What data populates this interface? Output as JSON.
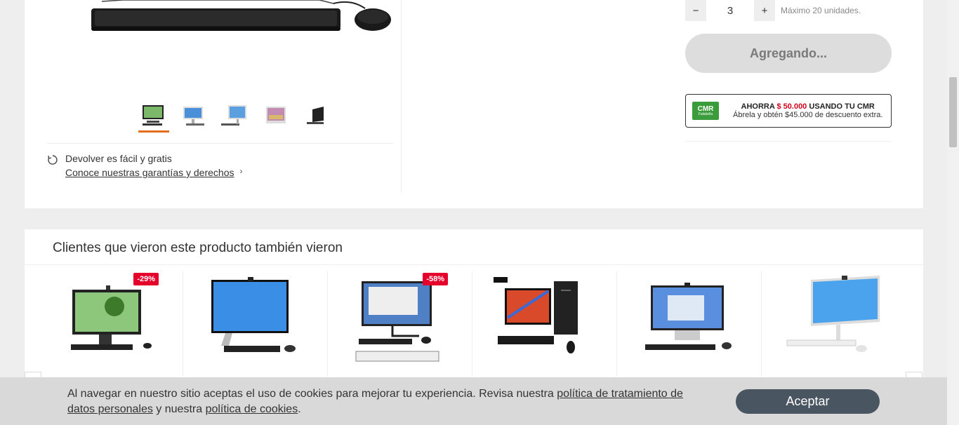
{
  "quantity": {
    "decrement": "−",
    "value": "3",
    "increment": "+",
    "max_label": "Máximo 20 unidades."
  },
  "add_button": "Agregando...",
  "cmr": {
    "logo": "CMR",
    "logo_sub": "Falabella",
    "line1_prefix": "AHORRA ",
    "line1_amount": "$ 50.000",
    "line1_suffix": " USANDO TU CMR",
    "line2": "Ábrela y obtén $45.000 de descuento extra."
  },
  "returns": {
    "title": "Devolver es fácil y gratis",
    "link": "Conoce nuestras garantías y derechos"
  },
  "recommendations": {
    "title": "Clientes que vieron este producto también vieron",
    "items": [
      {
        "badge": "-29%"
      },
      {
        "badge": ""
      },
      {
        "badge": "-58%"
      },
      {
        "badge": ""
      },
      {
        "badge": ""
      },
      {
        "badge": ""
      }
    ]
  },
  "cookie": {
    "text1": "Al navegar en nuestro sitio aceptas el uso de cookies para mejorar tu experiencia. Revisa nuestra ",
    "link1": "política de tratamiento de datos personales",
    "text2": " y nuestra ",
    "link2": "política de cookies",
    "text3": ".",
    "accept": "Aceptar"
  },
  "colors": {
    "accent": "#e4701e",
    "discount": "#e4002b",
    "cmr_green": "#3a9c3a",
    "accept_bg": "#4a5562"
  }
}
